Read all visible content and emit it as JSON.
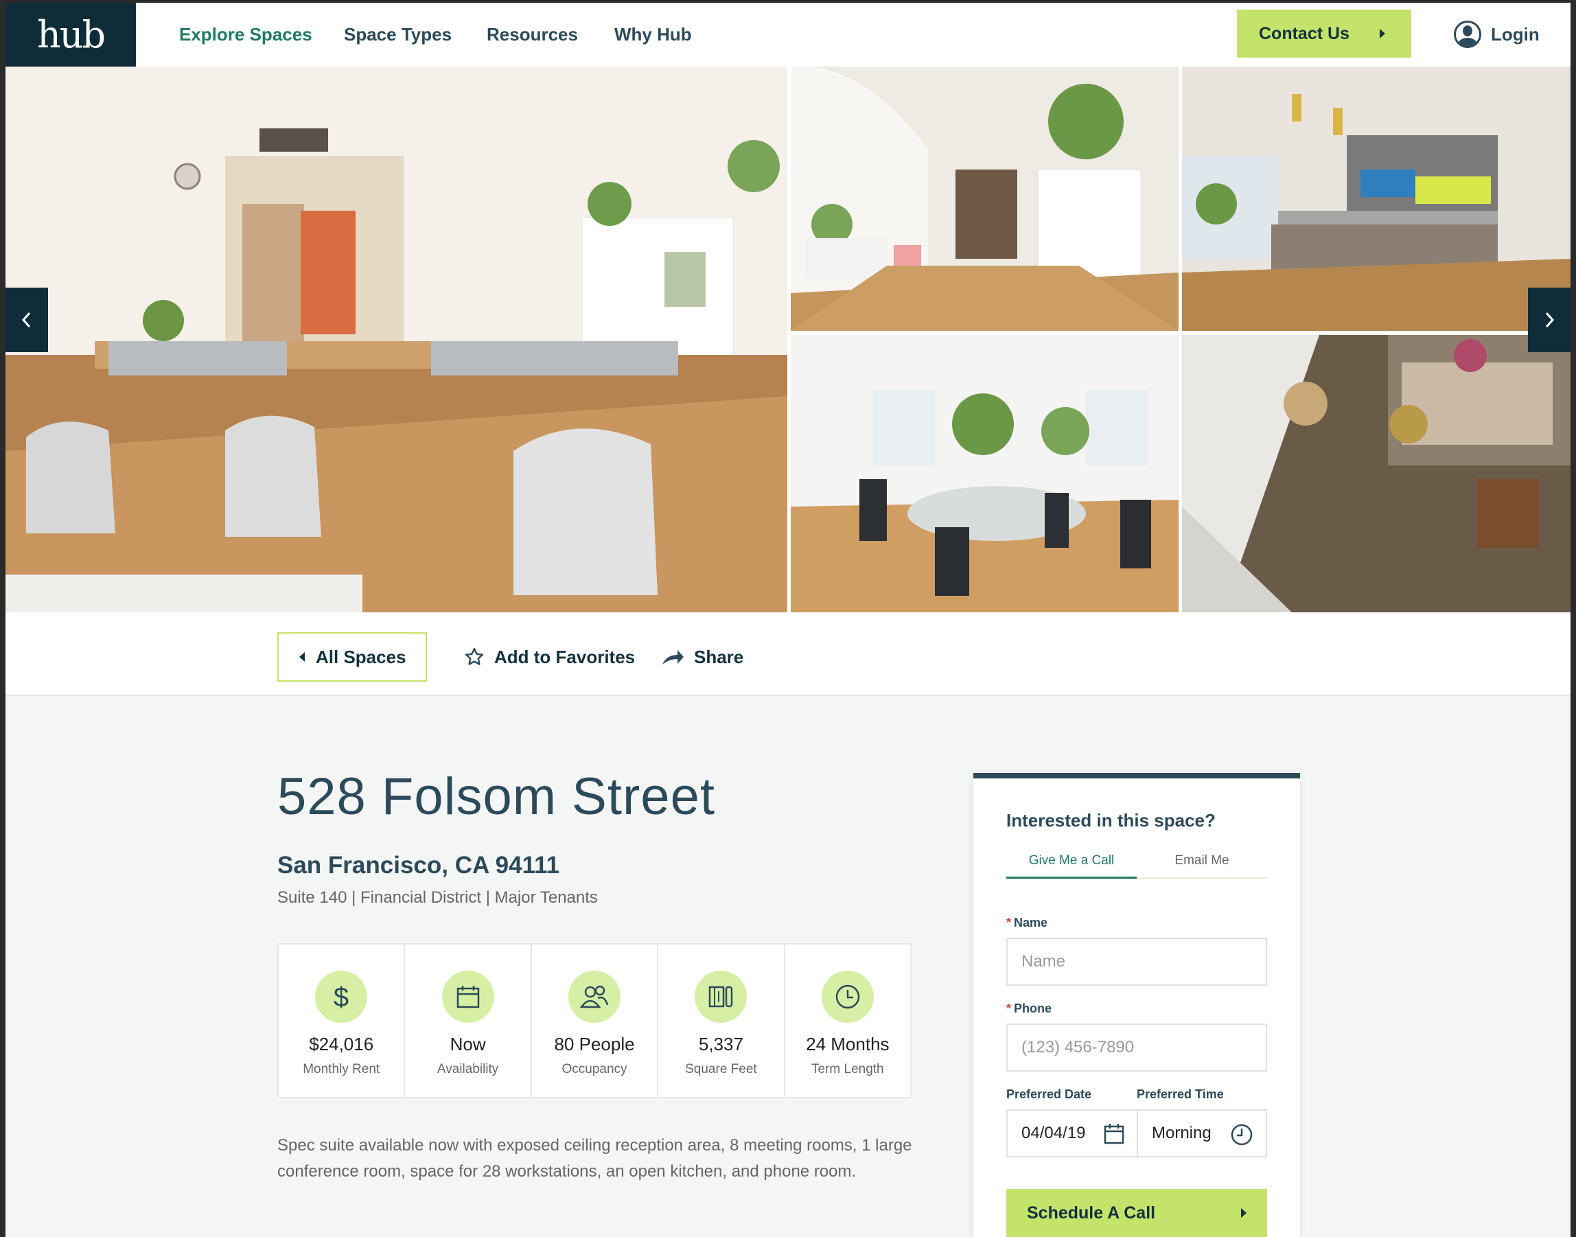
{
  "header": {
    "logo": "hub",
    "nav": [
      "Explore Spaces",
      "Space Types",
      "Resources",
      "Why Hub"
    ],
    "contact_label": "Contact Us",
    "login_label": "Login"
  },
  "actions": {
    "all_spaces": "All Spaces",
    "favorites": "Add to Favorites",
    "share": "Share"
  },
  "listing": {
    "title": "528 Folsom Street",
    "city": "San Francisco, CA 94111",
    "meta": "Suite 140 | Financial District | Major Tenants",
    "stats": [
      {
        "icon": "dollar-icon",
        "value": "$24,016",
        "label": "Monthly Rent"
      },
      {
        "icon": "calendar-icon",
        "value": "Now",
        "label": "Availability"
      },
      {
        "icon": "people-icon",
        "value": "80 People",
        "label": "Occupancy"
      },
      {
        "icon": "floorplan-icon",
        "value": "5,337",
        "label": "Square Feet"
      },
      {
        "icon": "clock-icon",
        "value": "24 Months",
        "label": "Term Length"
      }
    ],
    "description": "Spec suite available now with exposed ceiling reception area, 8 meeting rooms, 1 large conference room, space for 28 workstations, an open kitchen, and phone room."
  },
  "form": {
    "heading": "Interested in this space?",
    "tabs": [
      "Give Me a Call",
      "Email Me"
    ],
    "name_label": "Name",
    "name_placeholder": "Name",
    "phone_label": "Phone",
    "phone_placeholder": "(123) 456-7890",
    "date_label": "Preferred Date",
    "date_value": "04/04/19",
    "time_label": "Preferred Time",
    "time_value": "Morning",
    "submit_label": "Schedule A Call"
  },
  "colors": {
    "navy": "#0f2d39",
    "slate": "#2c4a5a",
    "lime": "#c3e36a",
    "green": "#1f7a63",
    "icon_bg": "#d6efa5"
  }
}
